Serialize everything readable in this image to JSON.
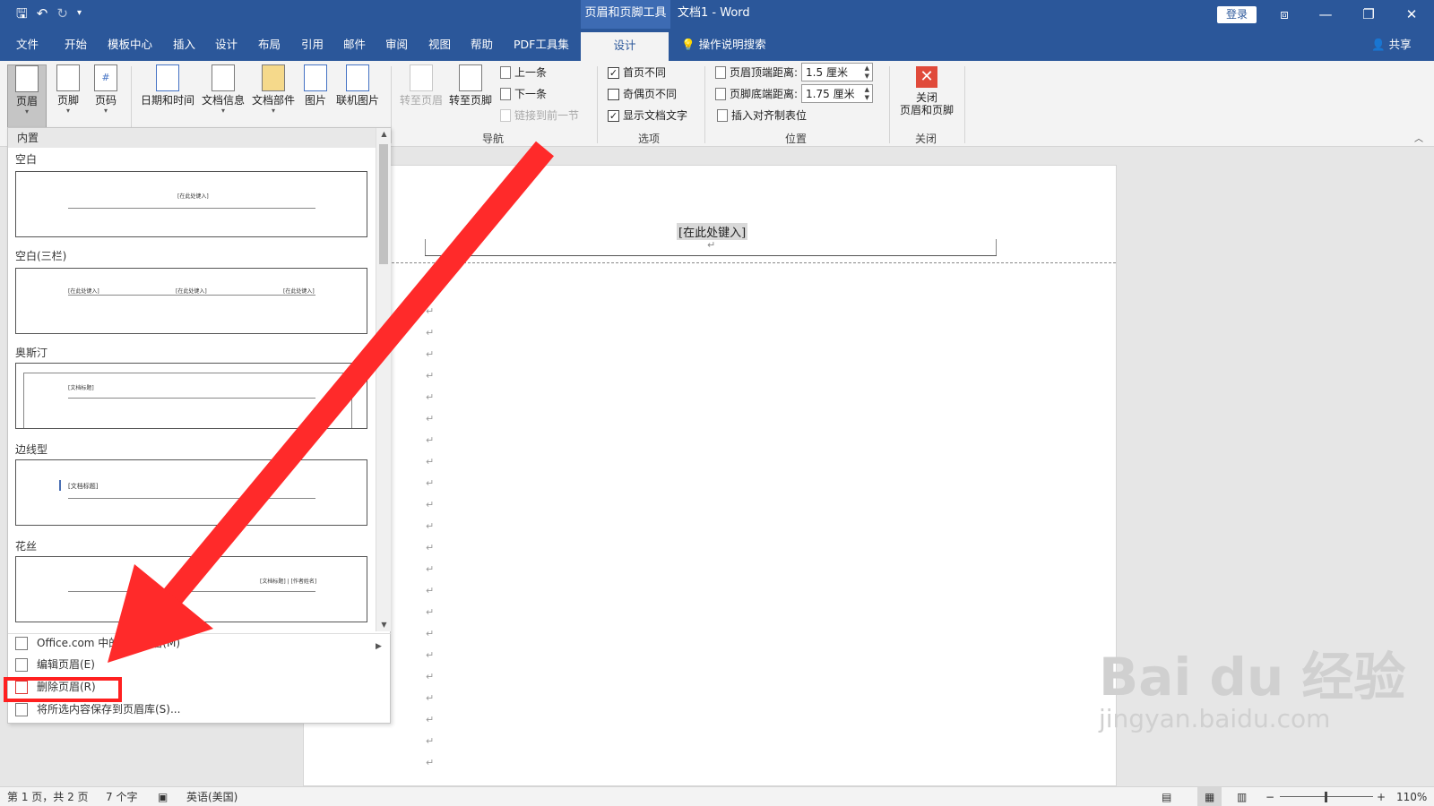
{
  "titlebar": {
    "context_tool": "页眉和页脚工具",
    "doc_title": "文档1  -  Word",
    "login": "登录",
    "qat_save": "🖫",
    "qat_undo": "↶",
    "qat_redo": "↻",
    "qat_more": "▾",
    "win_restore_ribbon": "⧈",
    "win_min": "—",
    "win_max": "❐",
    "win_close": "✕"
  },
  "tabs": [
    {
      "label": "文件"
    },
    {
      "label": "开始"
    },
    {
      "label": "模板中心"
    },
    {
      "label": "插入"
    },
    {
      "label": "设计"
    },
    {
      "label": "布局"
    },
    {
      "label": "引用"
    },
    {
      "label": "邮件"
    },
    {
      "label": "审阅"
    },
    {
      "label": "视图"
    },
    {
      "label": "帮助"
    },
    {
      "label": "PDF工具集"
    },
    {
      "label": "设计"
    }
  ],
  "tell_me": "操作说明搜索",
  "share": "共享",
  "ribbon": {
    "buttons": {
      "header": "页眉",
      "footer": "页脚",
      "page_number": "页码",
      "datetime": "日期和时间",
      "docinfo": "文档信息",
      "quickparts": "文档部件",
      "picture": "图片",
      "online_picture": "联机图片",
      "goto_header": "转至页眉",
      "goto_footer": "转至页脚"
    },
    "nav": {
      "prev": "上一条",
      "next": "下一条",
      "link_prev": "链接到前一节",
      "group": "导航"
    },
    "options": {
      "first_page": "首页不同",
      "odd_even": "奇偶页不同",
      "show_doc_text": "显示文档文字",
      "group": "选项",
      "first_page_checked": true,
      "odd_even_checked": false,
      "show_doc_text_checked": true
    },
    "position": {
      "header_top_label": "页眉顶端距离:",
      "header_top_value": "1.5 厘米",
      "footer_bottom_label": "页脚底端距离:",
      "footer_bottom_value": "1.75 厘米",
      "insert_tab": "插入对齐制表位",
      "group": "位置"
    },
    "close": {
      "label_line1": "关闭",
      "label_line2": "页眉和页脚",
      "group": "关闭"
    }
  },
  "dropdown": {
    "section": "内置",
    "categories": [
      {
        "name": "空白"
      },
      {
        "name": "空白(三栏)"
      },
      {
        "name": "奥斯汀"
      },
      {
        "name": "边线型"
      },
      {
        "name": "花丝"
      }
    ],
    "placeholders": {
      "blank": "[在此处键入]",
      "austin": "[文档标题]",
      "sideline": "[文档标题]",
      "filigree": "[文档标题] | [作者姓名]"
    },
    "menu": [
      {
        "label": "Office.com 中的其他页眉(M)"
      },
      {
        "label": "编辑页眉(E)"
      },
      {
        "label": "删除页眉(R)"
      },
      {
        "label": "将所选内容保存到页眉库(S)..."
      }
    ]
  },
  "document": {
    "header_placeholder": "[在此处键入]",
    "para_mark": "↵"
  },
  "statusbar": {
    "page": "第 1 页，共 2 页",
    "words": "7 个字",
    "language": "英语(美国)",
    "zoom": "110%",
    "zoom_minus": "−",
    "zoom_plus": "+"
  },
  "watermark": {
    "brand": "Bai du 经验",
    "url": "jingyan.baidu.com"
  },
  "colors": {
    "word_blue": "#2b579a",
    "annotation_red": "#ff2020"
  }
}
